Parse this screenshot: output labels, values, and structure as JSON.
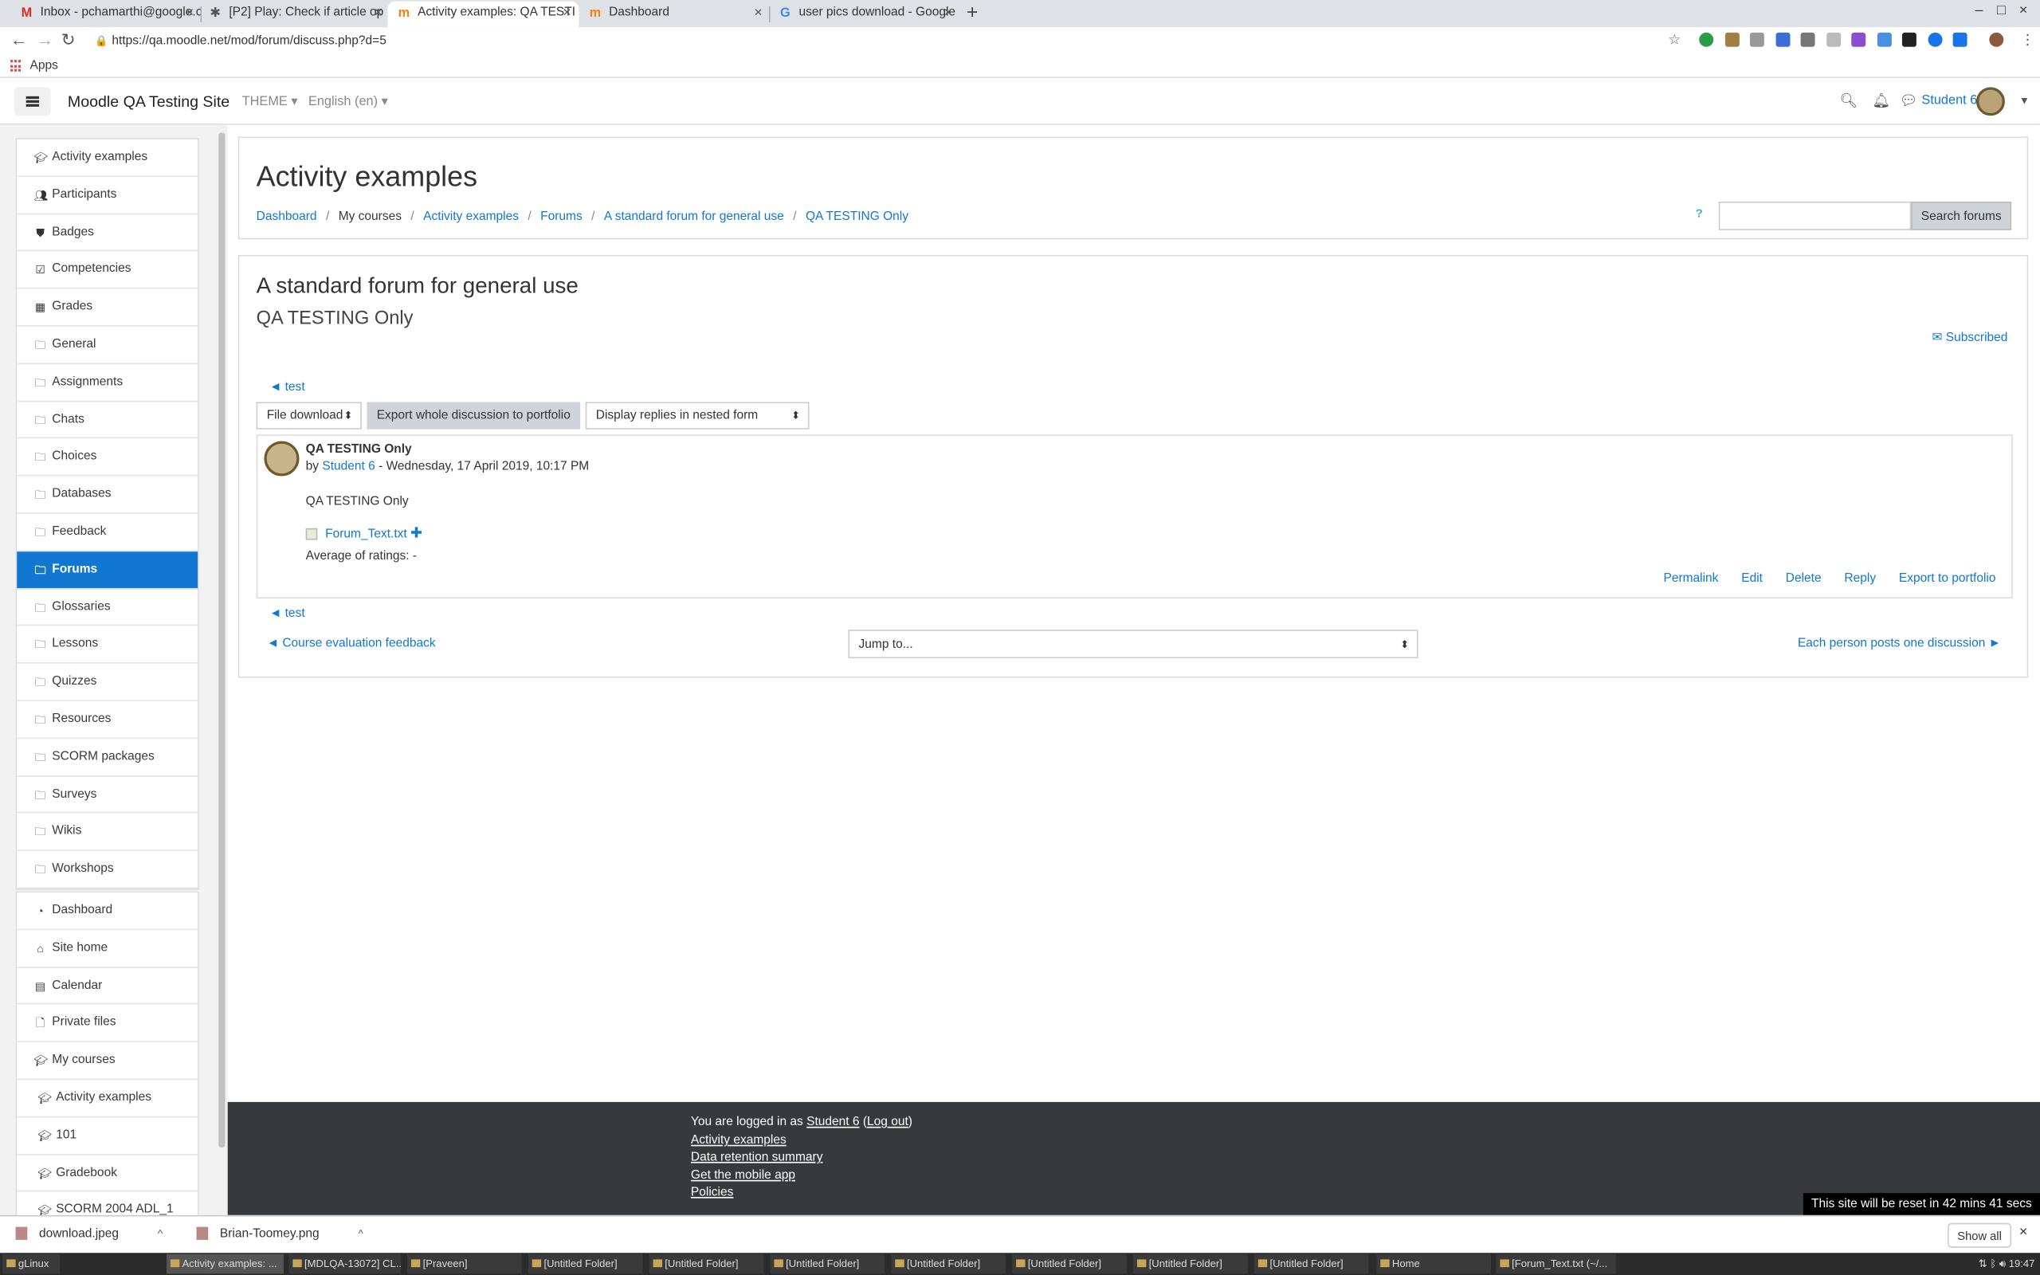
{
  "browser": {
    "tabs": [
      {
        "title": "Inbox - pchamarthi@google.c",
        "icon": "gmail-icon",
        "active": false
      },
      {
        "title": "[P2] Play: Check if article op",
        "icon": "bug-icon",
        "active": false
      },
      {
        "title": "Activity examples: QA TESTI",
        "icon": "moodle-icon",
        "active": true
      },
      {
        "title": "Dashboard",
        "icon": "moodle-icon",
        "active": false
      },
      {
        "title": "user pics download - Google",
        "icon": "google-icon",
        "active": false
      }
    ],
    "url": "https://qa.moodle.net/mod/forum/discuss.php?d=5",
    "bookmarks_apps": "Apps"
  },
  "navbar": {
    "site_name": "Moodle QA Testing Site",
    "theme_menu": "THEME",
    "language_menu": "English (en)",
    "user_name": "Student 6"
  },
  "drawer": {
    "course_items": [
      {
        "label": "Activity examples",
        "icon": "graduation-cap-icon"
      },
      {
        "label": "Participants",
        "icon": "users-icon"
      },
      {
        "label": "Badges",
        "icon": "shield-icon"
      },
      {
        "label": "Competencies",
        "icon": "check-square-icon"
      },
      {
        "label": "Grades",
        "icon": "table-icon"
      },
      {
        "label": "General",
        "icon": "folder-icon"
      },
      {
        "label": "Assignments",
        "icon": "folder-icon"
      },
      {
        "label": "Chats",
        "icon": "folder-icon"
      },
      {
        "label": "Choices",
        "icon": "folder-icon"
      },
      {
        "label": "Databases",
        "icon": "folder-icon"
      },
      {
        "label": "Feedback",
        "icon": "folder-icon"
      },
      {
        "label": "Forums",
        "icon": "folder-icon",
        "active": true
      },
      {
        "label": "Glossaries",
        "icon": "folder-icon"
      },
      {
        "label": "Lessons",
        "icon": "folder-icon"
      },
      {
        "label": "Quizzes",
        "icon": "folder-icon"
      },
      {
        "label": "Resources",
        "icon": "folder-icon"
      },
      {
        "label": "SCORM packages",
        "icon": "folder-icon"
      },
      {
        "label": "Surveys",
        "icon": "folder-icon"
      },
      {
        "label": "Wikis",
        "icon": "folder-icon"
      },
      {
        "label": "Workshops",
        "icon": "folder-icon"
      }
    ],
    "site_items": [
      {
        "label": "Dashboard",
        "icon": "dashboard-icon"
      },
      {
        "label": "Site home",
        "icon": "home-icon"
      },
      {
        "label": "Calendar",
        "icon": "calendar-icon"
      },
      {
        "label": "Private files",
        "icon": "file-icon"
      },
      {
        "label": "My courses",
        "icon": "graduation-cap-icon"
      },
      {
        "label": "Activity examples",
        "icon": "graduation-cap-icon",
        "sub": true
      },
      {
        "label": "101",
        "icon": "graduation-cap-icon",
        "sub": true
      },
      {
        "label": "Gradebook",
        "icon": "graduation-cap-icon",
        "sub": true
      },
      {
        "label": "SCORM 2004 ADL_1",
        "icon": "graduation-cap-icon",
        "sub": true
      }
    ]
  },
  "header": {
    "title": "Activity examples",
    "breadcrumbs": [
      "Dashboard",
      "My courses",
      "Activity examples",
      "Forums",
      "A standard forum for general use",
      "QA TESTING Only"
    ],
    "search_button": "Search forums"
  },
  "forum": {
    "title": "A standard forum for general use",
    "discussion": "QA TESTING Only",
    "subscribed": "Subscribed",
    "prev_link": "test",
    "next_link": "test",
    "portfolio_select": "File download",
    "export_button": "Export whole discussion to portfolio",
    "display_select": "Display replies in nested form",
    "post": {
      "subject": "QA TESTING Only",
      "by_prefix": "by",
      "author": "Student 6",
      "date": "- Wednesday, 17 April 2019, 10:17 PM",
      "body": "QA TESTING Only",
      "attachment": "Forum_Text.txt",
      "rating": "Average of ratings: -",
      "actions": [
        "Permalink",
        "Edit",
        "Delete",
        "Reply",
        "Export to portfolio"
      ]
    },
    "prev_activity": "◄ Course evaluation feedback",
    "jump_to": "Jump to...",
    "next_activity": "Each person posts one discussion ►"
  },
  "footer": {
    "logged_in_prefix": "You are logged in as",
    "user": "Student 6",
    "logout": "Log out",
    "links": [
      "Activity examples",
      "Data retention summary",
      "Get the mobile app",
      "Policies"
    ],
    "reset_notice": "This site will be reset in 42 mins 41 secs"
  },
  "downloads": {
    "items": [
      "download.jpeg",
      "Brian-Toomey.png"
    ],
    "show_all": "Show all"
  },
  "taskbar": {
    "items": [
      "gLinux",
      "Activity examples: ...",
      "[MDLQA-13072] CL...",
      "[Praveen]",
      "[Untitled Folder]",
      "[Untitled Folder]",
      "[Untitled Folder]",
      "[Untitled Folder]",
      "[Untitled Folder]",
      "[Untitled Folder]",
      "[Untitled Folder]",
      "Home",
      "[Forum_Text.txt (~/..."
    ],
    "clock": "19:47"
  },
  "colors": {
    "link": "#1177d1",
    "active_nav": "#1177d1",
    "footer_bg": "#373a3c"
  }
}
